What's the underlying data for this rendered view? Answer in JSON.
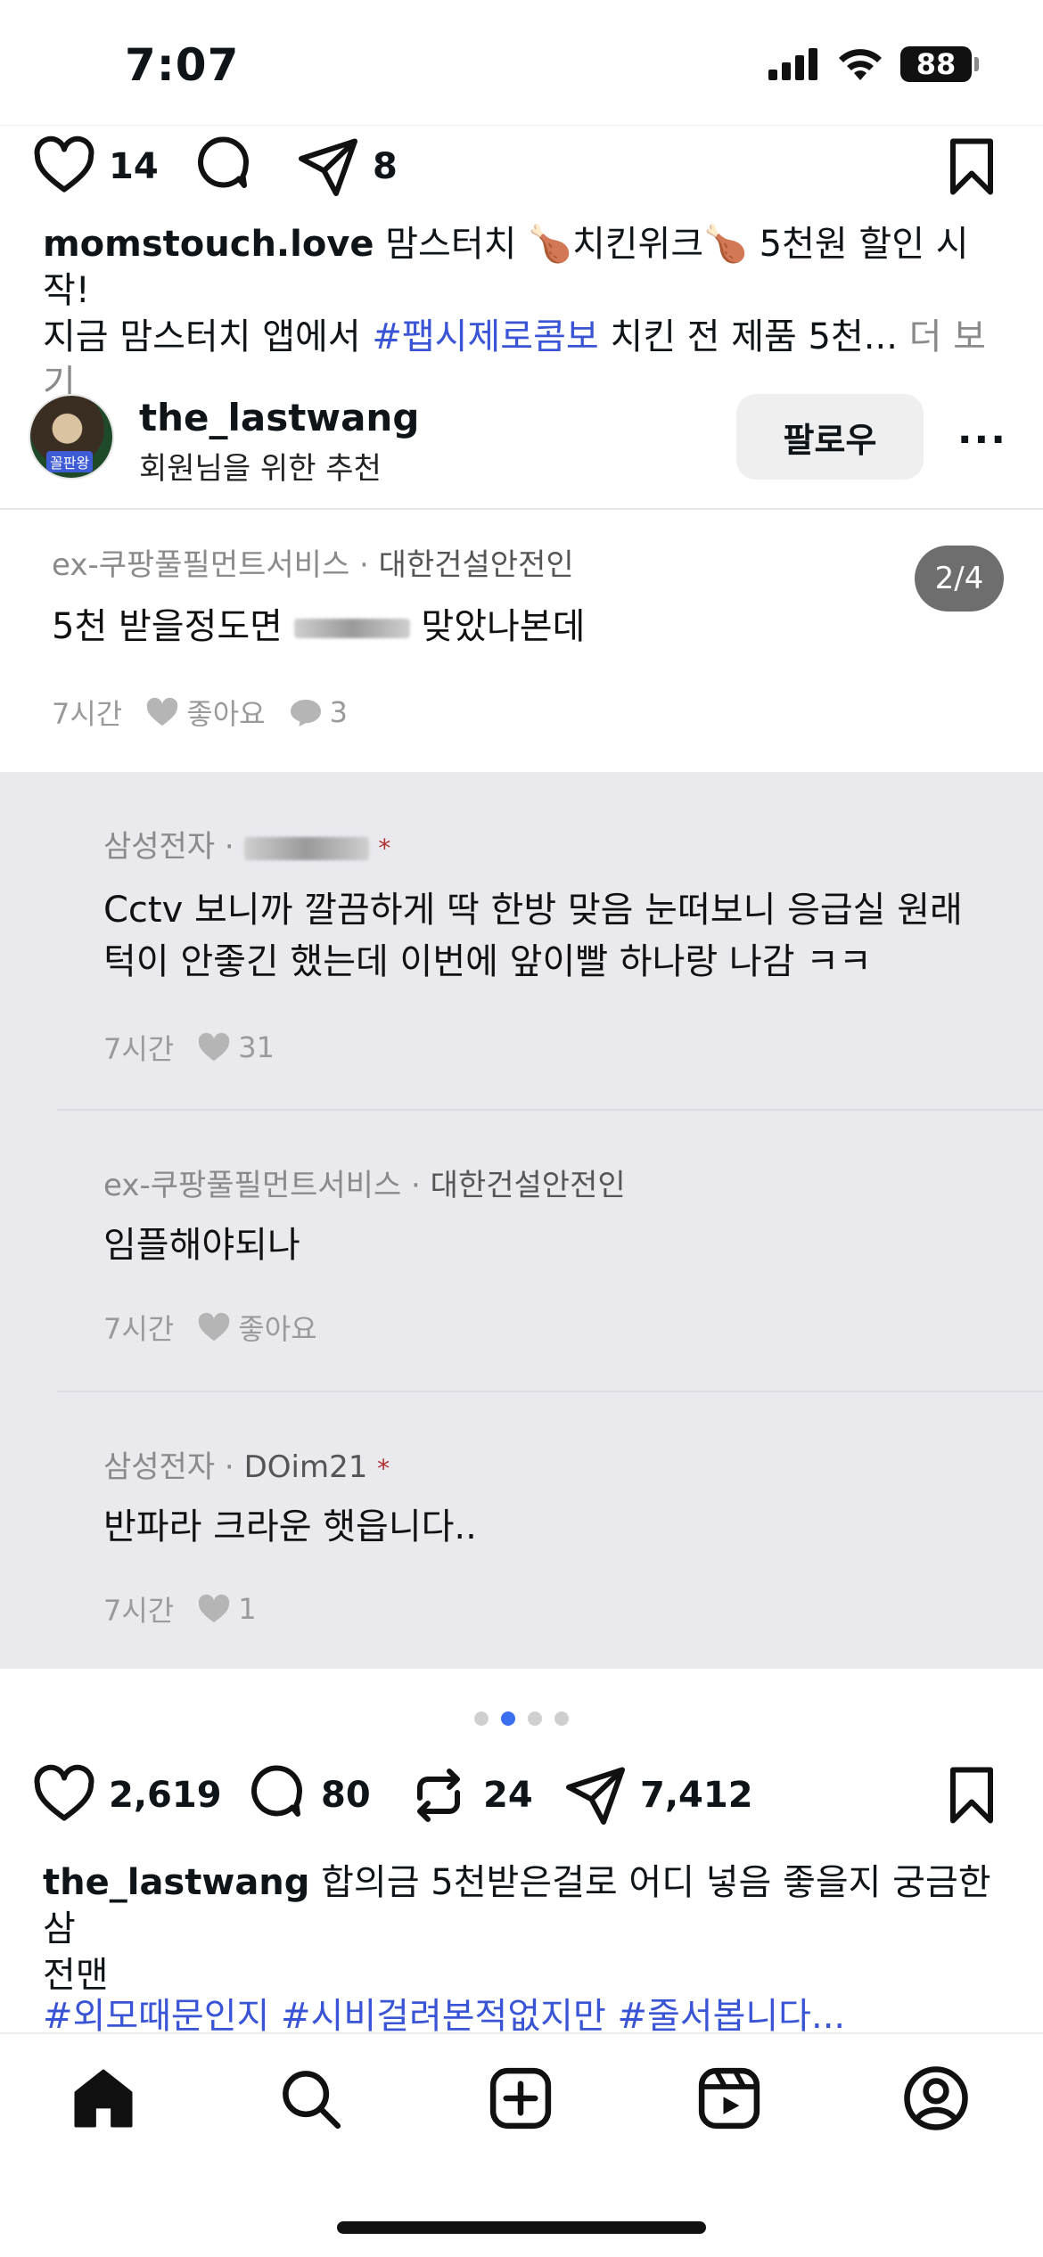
{
  "status_bar": {
    "time": "7:07",
    "battery": "88"
  },
  "prev_post": {
    "likes": "14",
    "shares": "8",
    "caption_user": "momstouch.love",
    "caption_line1": "맘스터치 🍗치킨위크🍗 5천원 할인 시작!",
    "caption_line2_prefix": "지금 맘스터치 앱에서 ",
    "caption_tag": "#팹시제로콤보",
    "caption_line2_suffix": " 치킨 전 제품 5천...",
    "more_label": "더 보기"
  },
  "post": {
    "username": "the_lastwang",
    "subline": "회원님을 위한 추천",
    "avatar_label": "꼴판왕",
    "follow_label": "팔로우",
    "more_label": "···",
    "page_badge": "2/4"
  },
  "main_comment": {
    "company": "ex-쿠팡풀필먼트서비스 ·",
    "job": "대한건설안전인",
    "text_before": "5천 받을정도면 ",
    "text_after": " 맞았나본데",
    "time": "7시간",
    "like_label": "좋아요",
    "comments": "3"
  },
  "replies": [
    {
      "company": "삼성전자 ·",
      "author": "",
      "line1": "Cctv 보니까 깔끔하게 딱 한방 맞음 눈떠보니 응급실 원래",
      "line2": "턱이 안좋긴 했는데 이번에 앞이빨 하나랑 나감 ㅋㅋ",
      "time": "7시간",
      "likes": "31"
    },
    {
      "company": "ex-쿠팡풀필먼트서비스 ·",
      "author": "대한건설안전인",
      "line1": "임플해야되나",
      "time": "7시간",
      "likes": "좋아요"
    },
    {
      "company": "삼성전자 ·",
      "author": "DOim21",
      "line1": "반파라 크라운 햇읍니다..",
      "time": "7시간",
      "likes": "1"
    }
  ],
  "actions": {
    "likes": "2,619",
    "comments": "80",
    "reposts": "24",
    "shares": "7,412"
  },
  "caption": {
    "user": "the_lastwang",
    "text_line1": " 합의금 5천받은걸로 어디 넣음 좋을지 궁금한 삼",
    "text_line2": "전맨",
    "tags": "#외모때문인지 #시비걸려본적없지만 #줄서봅니다..."
  }
}
